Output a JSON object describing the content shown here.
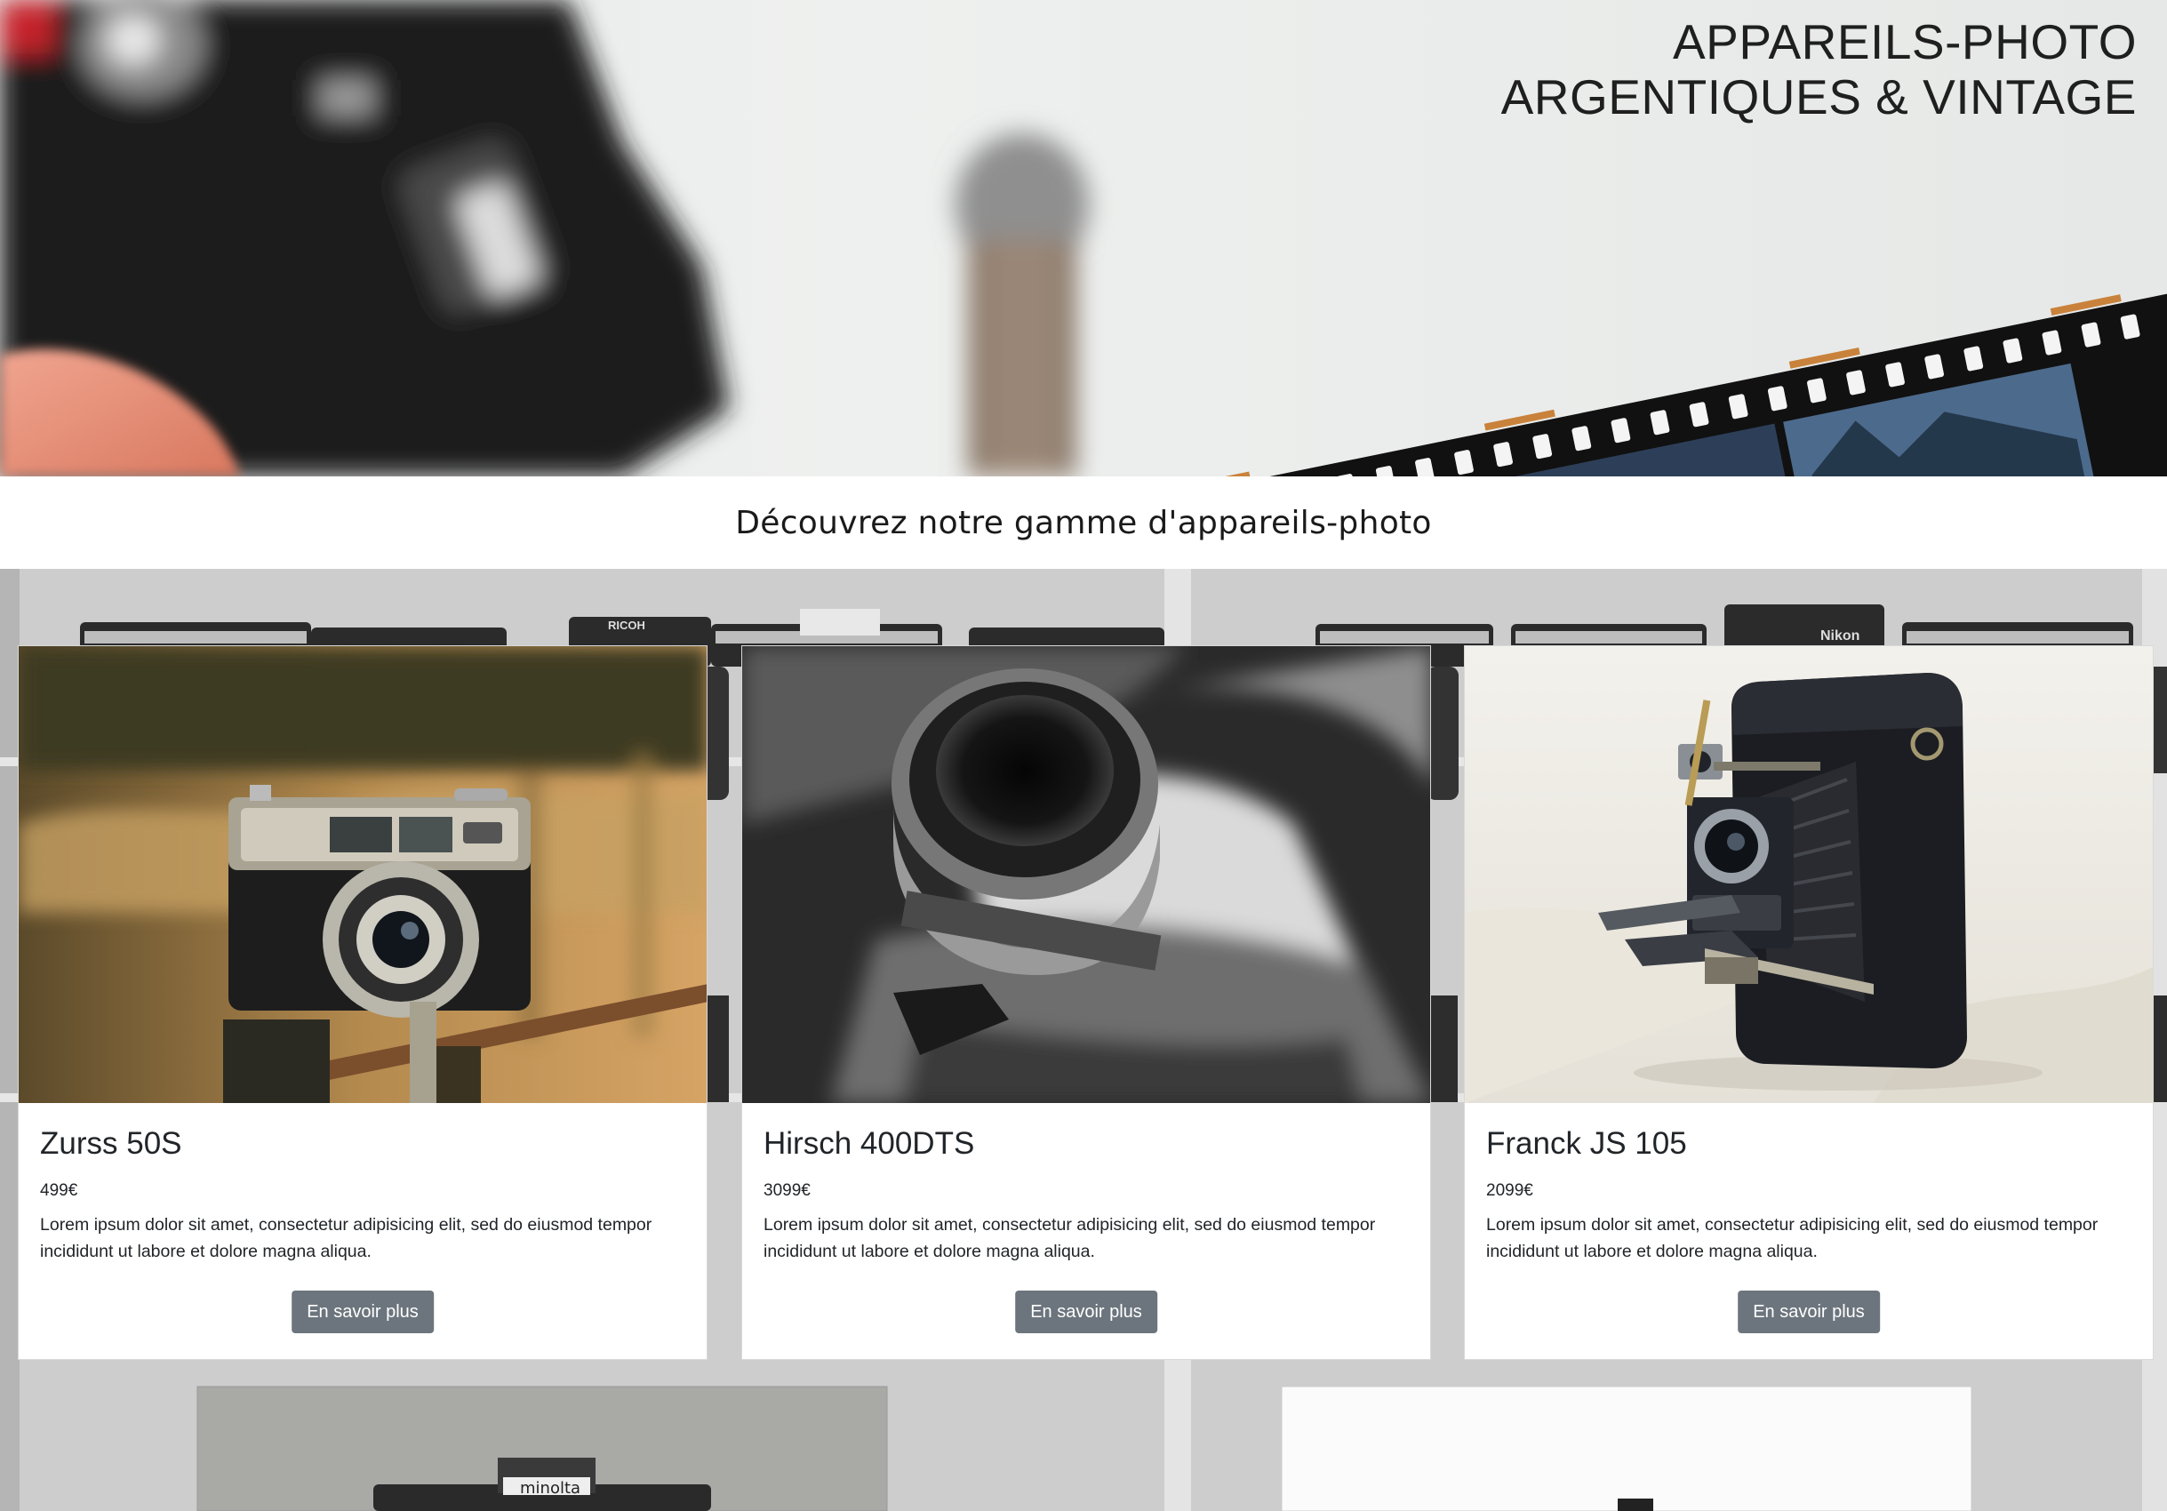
{
  "hero": {
    "title_line1": "APPAREILS-PHOTO",
    "title_line2": "ARGENTIQUES & VINTAGE"
  },
  "section": {
    "subtitle": "Découvrez notre gamme d'appareils-photo"
  },
  "products": [
    {
      "name": "Zurss 50S",
      "price": "499€",
      "description": "Lorem ipsum dolor sit amet, consectetur adipisicing elit, sed do eiusmod tempor incididunt ut labore et dolore magna aliqua.",
      "button": "En savoir plus"
    },
    {
      "name": "Hirsch 400DTS",
      "price": "3099€",
      "description": "Lorem ipsum dolor sit amet, consectetur adipisicing elit, sed do eiusmod tempor incididunt ut labore et dolore magna aliqua.",
      "button": "En savoir plus"
    },
    {
      "name": "Franck JS 105",
      "price": "2099€",
      "description": "Lorem ipsum dolor sit amet, consectetur adipisicing elit, sed do eiusmod tempor incididunt ut labore et dolore magna aliqua.",
      "button": "En savoir plus"
    }
  ],
  "colors": {
    "button_bg": "#6c757d",
    "button_text": "#ffffff",
    "card_bg": "#ffffff",
    "subtitle_bar_bg": "#ffffff"
  }
}
